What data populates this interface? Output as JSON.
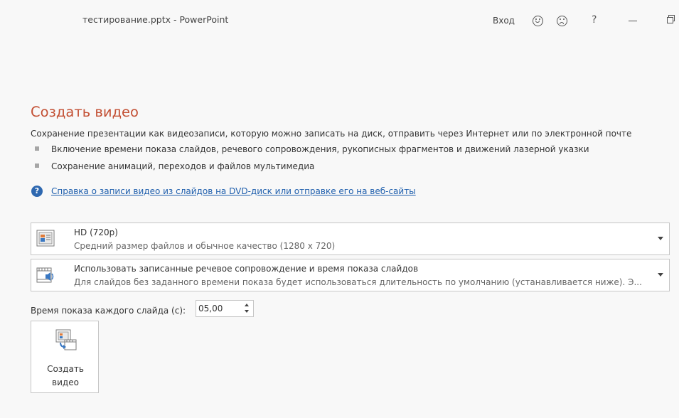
{
  "window": {
    "title": "тестирование.pptx  -  PowerPoint",
    "signin_label": "Вход",
    "help_label": "?"
  },
  "main": {
    "title": "Создать видео",
    "description": "Сохранение презентации как видеозаписи, которую можно записать на диск, отправить через Интернет или по электронной почте",
    "bullets": [
      "Включение времени показа слайдов, речевого сопровождения, рукописных фрагментов и движений лазерной указки",
      "Сохранение анимаций, переходов и файлов мультимедиа"
    ],
    "help_link": "Справка о записи видео из слайдов на DVD-диск или отправке его на веб-сайты"
  },
  "quality_dropdown": {
    "main": "HD (720p)",
    "sub": "Средний размер файлов и обычное качество (1280 x 720)",
    "icon": "presentation-quality-icon"
  },
  "narration_dropdown": {
    "main": "Использовать записанные речевое сопровождение и время показа слайдов",
    "sub": "Для слайдов без заданного времени показа будет использоваться длительность по умолчанию (устанавливается ниже). Э...",
    "icon": "filmstrip-audio-icon"
  },
  "slide_time": {
    "label": "Время показа каждого слайда (с):",
    "value": "05,00"
  },
  "create_button": {
    "label_line1": "Создать",
    "label_line2": "видео",
    "icon": "create-video-icon"
  },
  "colors": {
    "accent": "#c35034",
    "link": "#1f5fad",
    "background": "#f8f8f8"
  }
}
